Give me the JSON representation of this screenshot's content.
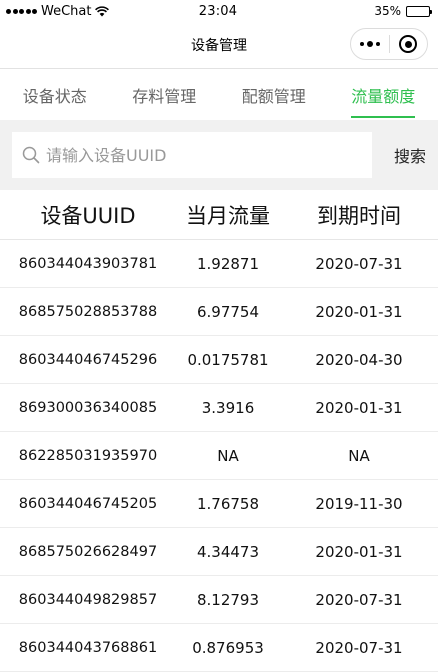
{
  "status_bar": {
    "carrier": "WeChat",
    "time": "23:04",
    "battery": "35%",
    "battery_level": 0.35
  },
  "nav": {
    "title": "设备管理"
  },
  "tabs": [
    {
      "label": "设备状态",
      "active": false
    },
    {
      "label": "存料管理",
      "active": false
    },
    {
      "label": "配额管理",
      "active": false
    },
    {
      "label": "流量额度",
      "active": true
    }
  ],
  "search": {
    "placeholder": "请输入设备UUID",
    "button_label": "搜索"
  },
  "table": {
    "headers": [
      "设备UUID",
      "当月流量",
      "到期时间"
    ],
    "rows": [
      [
        "860344043903781",
        "1.92871",
        "2020-07-31"
      ],
      [
        "868575028853788",
        "6.97754",
        "2020-01-31"
      ],
      [
        "860344046745296",
        "0.0175781",
        "2020-04-30"
      ],
      [
        "869300036340085",
        "3.3916",
        "2020-01-31"
      ],
      [
        "862285031935970",
        "NA",
        "NA"
      ],
      [
        "860344046745205",
        "1.76758",
        "2019-11-30"
      ],
      [
        "868575026628497",
        "4.34473",
        "2020-01-31"
      ],
      [
        "860344049829857",
        "8.12793",
        "2020-07-31"
      ],
      [
        "860344043768861",
        "0.876953",
        "2020-07-31"
      ]
    ]
  },
  "colors": {
    "accent": "#2fbf4f",
    "search_bg": "#f1f1f1"
  }
}
